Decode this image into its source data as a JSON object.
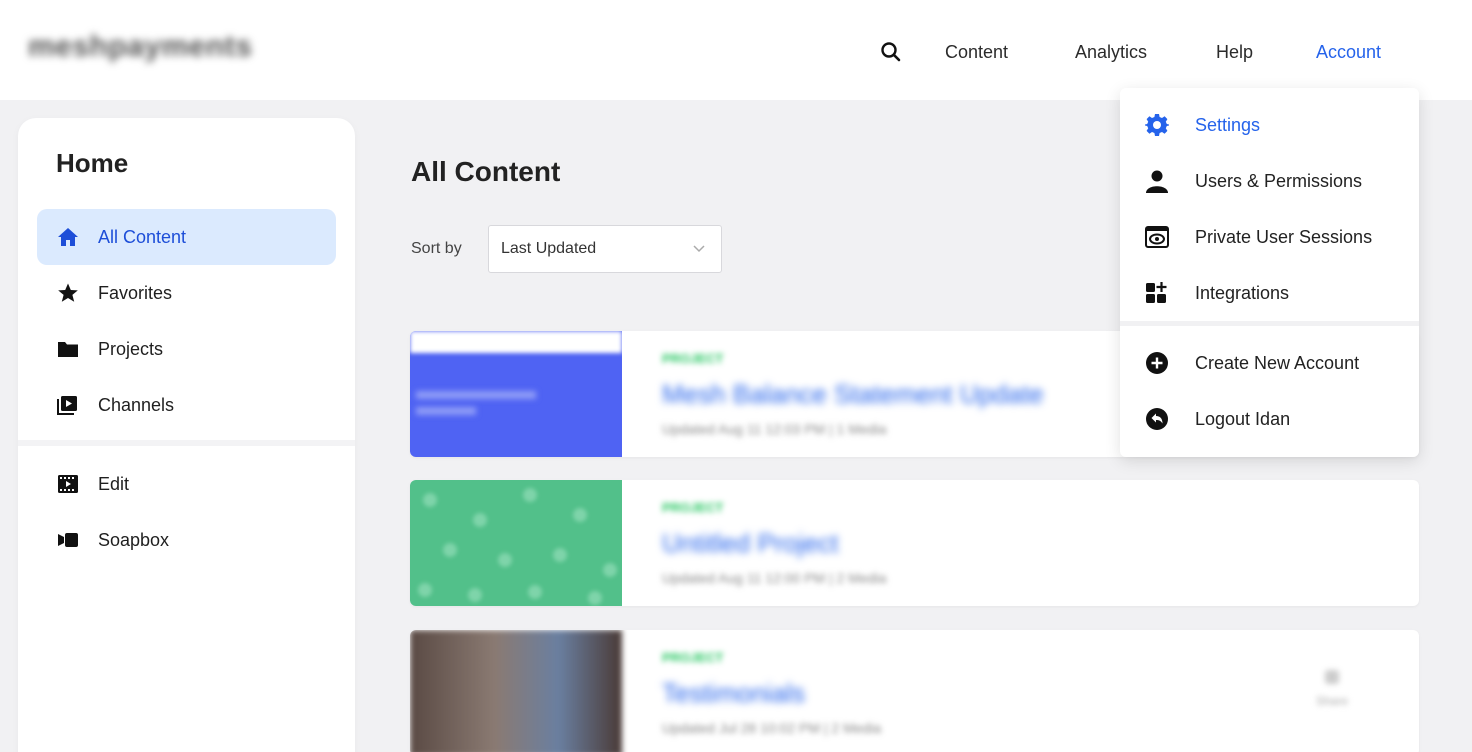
{
  "brand": {
    "logo_text": "meshpayments"
  },
  "nav": {
    "items": [
      {
        "label": "Content"
      },
      {
        "label": "Analytics"
      },
      {
        "label": "Help"
      },
      {
        "label": "Account"
      }
    ]
  },
  "sidebar": {
    "title": "Home",
    "items": [
      {
        "label": "All Content",
        "icon": "home-icon"
      },
      {
        "label": "Favorites",
        "icon": "star-icon"
      },
      {
        "label": "Projects",
        "icon": "folder-icon"
      },
      {
        "label": "Channels",
        "icon": "channels-icon"
      },
      {
        "label": "Edit",
        "icon": "film-icon"
      },
      {
        "label": "Soapbox",
        "icon": "soapbox-icon"
      }
    ]
  },
  "main": {
    "title": "All Content",
    "sort": {
      "label": "Sort by",
      "value": "Last Updated"
    },
    "cards": [
      {
        "tag": "PROJECT",
        "title": "Mesh Balance Statement Update",
        "meta": "Updated Aug 11 12:03 PM | 1 Media",
        "thumb_color": "#4f63f3"
      },
      {
        "tag": "PROJECT",
        "title": "Untitled Project",
        "meta": "Updated Aug 11 12:00 PM | 2 Media",
        "thumb_color": "#52c08a"
      },
      {
        "tag": "PROJECT",
        "title": "Testimonials",
        "meta": "Updated Jul 28 10:02 PM | 2 Media",
        "thumb_color": "#6b5a52",
        "stat": "Share"
      }
    ]
  },
  "account_menu": {
    "items": [
      {
        "label": "Settings",
        "icon": "gear-icon"
      },
      {
        "label": "Users & Permissions",
        "icon": "user-icon"
      },
      {
        "label": "Private User Sessions",
        "icon": "eye-icon"
      },
      {
        "label": "Integrations",
        "icon": "integrations-icon"
      },
      {
        "label": "Create New Account",
        "icon": "plus-circle-icon"
      },
      {
        "label": "Logout Idan",
        "icon": "logout-icon"
      }
    ]
  },
  "colors": {
    "accent": "#2563eb",
    "active_bg": "#dbeafe",
    "page_bg": "#f1f1f3"
  }
}
